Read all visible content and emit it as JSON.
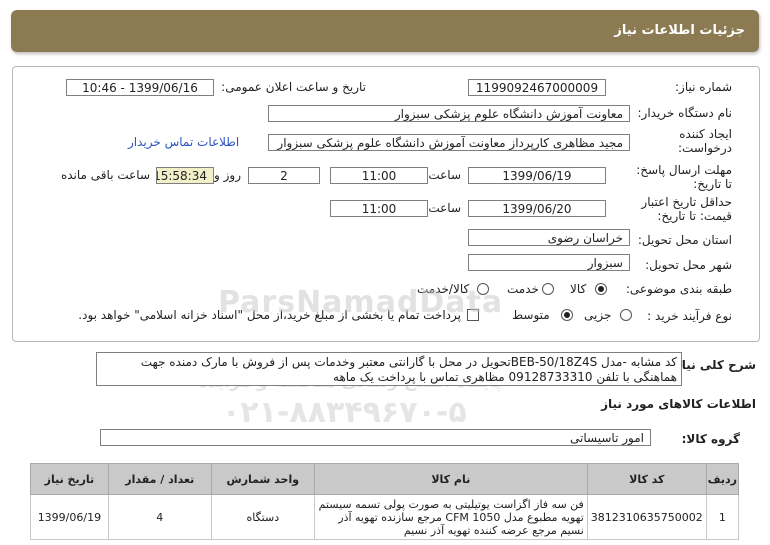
{
  "header": {
    "title": "جزئیات اطلاعات نیاز"
  },
  "form": {
    "need_number_label": "شماره نیاز:",
    "need_number": "1199092467000009",
    "announce_label": "تاریخ و ساعت اعلان عمومی:",
    "announce_value": "1399/06/16 - 10:46",
    "buyer_org_label": "نام دستگاه خریدار:",
    "buyer_org": "معاونت آموزش دانشگاه علوم پزشکی سبزوار",
    "creator_label_1": "ایجاد کننده",
    "creator_label_2": "درخواست:",
    "creator": "مجید مظاهری کارپرداز معاونت آموزش دانشگاه علوم پزشکی سبزوار",
    "buyer_contact_link": "اطلاعات تماس خریدار",
    "deadline_label_1": "مهلت ارسال پاسخ:",
    "deadline_label_2": "تا تاریخ:",
    "deadline_date": "1399/06/19",
    "time_label": "ساعت",
    "deadline_time": "11:00",
    "days_count": "2",
    "days_label": "روز و",
    "remaining_time": "15:58:34",
    "remaining_label": "ساعت باقی مانده",
    "validity_label_1": "حداقل تاریخ اعتبار",
    "validity_label_2": "قیمت: تا تاریخ:",
    "validity_date": "1399/06/20",
    "validity_time_label": "ساعت",
    "validity_time": "11:00",
    "province_label": "استان محل تحویل:",
    "province": "خراسان رضوی",
    "city_label": "شهر محل تحویل:",
    "city": "سبزوار",
    "category_label": "طبقه بندی موضوعی:",
    "category_options": [
      "کالا",
      "خدمت",
      "کالا/خدمت"
    ],
    "category_selected": "کالا",
    "process_label": "نوع فرآیند خرید :",
    "process_options": [
      "جزیی",
      "متوسط"
    ],
    "process_selected": "متوسط",
    "payment_note": "پرداخت تمام یا بخشی از مبلغ خرید،از محل \"اسناد خزانه اسلامی\" خواهد بود."
  },
  "description": {
    "label": "شرح کلی نیاز:",
    "text": "کد مشابه -مدل BEB-50/18Z4Sتحویل در محل با گارانتی معتبر وخدمات پس از فروش با مارک دمنده جهت هماهنگی با تلفن 09128733310 مظاهری تماس با پرداخت یک ماهه"
  },
  "goods": {
    "section_title": "اطلاعات کالاهای مورد نیاز",
    "group_label": "گروه کالا:",
    "group_value": "امور تاسیساتی",
    "columns": [
      "ردیف",
      "کد کالا",
      "نام کالا",
      "واحد شمارش",
      "تعداد / مقدار",
      "تاریخ نیاز"
    ],
    "rows": [
      {
        "row": "1",
        "code": "3812310635750002",
        "name": "فن سه فاز اگزاست یوتیلیتی به صورت پولی تسمه سیستم تهویه مطبوع مدل CFM 1050 مرجع سازنده تهویه آذر نسیم مرجع عرضه کننده تهویه آذر نسیم",
        "unit": "دستگاه",
        "qty": "4",
        "date": "1399/06/19"
      }
    ]
  },
  "watermark": {
    "brand": "ParsNamadData",
    "line1": "پایگاه اطلاع رسانی مناقصه و مزایده",
    "phone": "۰۲۱-۸۸۳۴۹۶۷۰-۵"
  }
}
